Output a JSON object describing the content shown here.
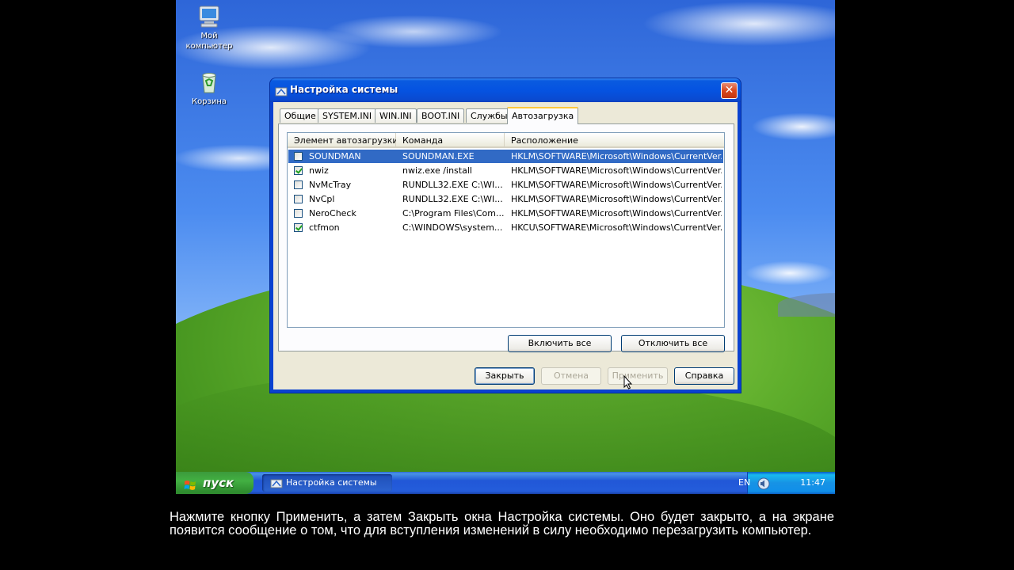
{
  "desktop": {
    "icons": [
      {
        "label_line1": "Мой",
        "label_line2": "компьютер",
        "icon": "my-computer-icon"
      },
      {
        "label_line1": "Корзина",
        "icon": "recycle-bin-icon"
      }
    ]
  },
  "window": {
    "title": "Настройка системы",
    "tabs": [
      "Общие",
      "SYSTEM.INI",
      "WIN.INI",
      "BOOT.INI",
      "Службы",
      "Автозагрузка"
    ],
    "active_tab": "Автозагрузка",
    "columns": [
      "Элемент автозагрузки",
      "Команда",
      "Расположение"
    ],
    "rows": [
      {
        "checked": false,
        "item": "SOUNDMAN",
        "command": "SOUNDMAN.EXE",
        "location": "HKLM\\SOFTWARE\\Microsoft\\Windows\\CurrentVer...",
        "selected": true
      },
      {
        "checked": true,
        "item": "nwiz",
        "command": "nwiz.exe /install",
        "location": "HKLM\\SOFTWARE\\Microsoft\\Windows\\CurrentVer...",
        "selected": false
      },
      {
        "checked": false,
        "item": "NvMcTray",
        "command": "RUNDLL32.EXE C:\\WI...",
        "location": "HKLM\\SOFTWARE\\Microsoft\\Windows\\CurrentVer...",
        "selected": false
      },
      {
        "checked": false,
        "item": "NvCpl",
        "command": "RUNDLL32.EXE C:\\WI...",
        "location": "HKLM\\SOFTWARE\\Microsoft\\Windows\\CurrentVer...",
        "selected": false
      },
      {
        "checked": false,
        "item": "NeroCheck",
        "command": "C:\\Program Files\\Com...",
        "location": "HKLM\\SOFTWARE\\Microsoft\\Windows\\CurrentVer...",
        "selected": false
      },
      {
        "checked": true,
        "item": "ctfmon",
        "command": "C:\\WINDOWS\\system...",
        "location": "HKCU\\SOFTWARE\\Microsoft\\Windows\\CurrentVer...",
        "selected": false
      }
    ],
    "enable_all_label": "Включить все",
    "disable_all_label": "Отключить все",
    "buttons": {
      "close": "Закрыть",
      "cancel": "Отмена",
      "apply": "Применить",
      "help": "Справка"
    }
  },
  "taskbar": {
    "start_label": "пуск",
    "task_label": "Настройка системы",
    "lang": "EN",
    "clock": "11:47"
  },
  "subtitle": "Нажмите кнопку Применить, а затем Закрыть окна Настройка системы. Оно будет закрыто, а на экране появится сообщение о том, что для вступления изменений в силу необходимо перезагрузить компьютер."
}
